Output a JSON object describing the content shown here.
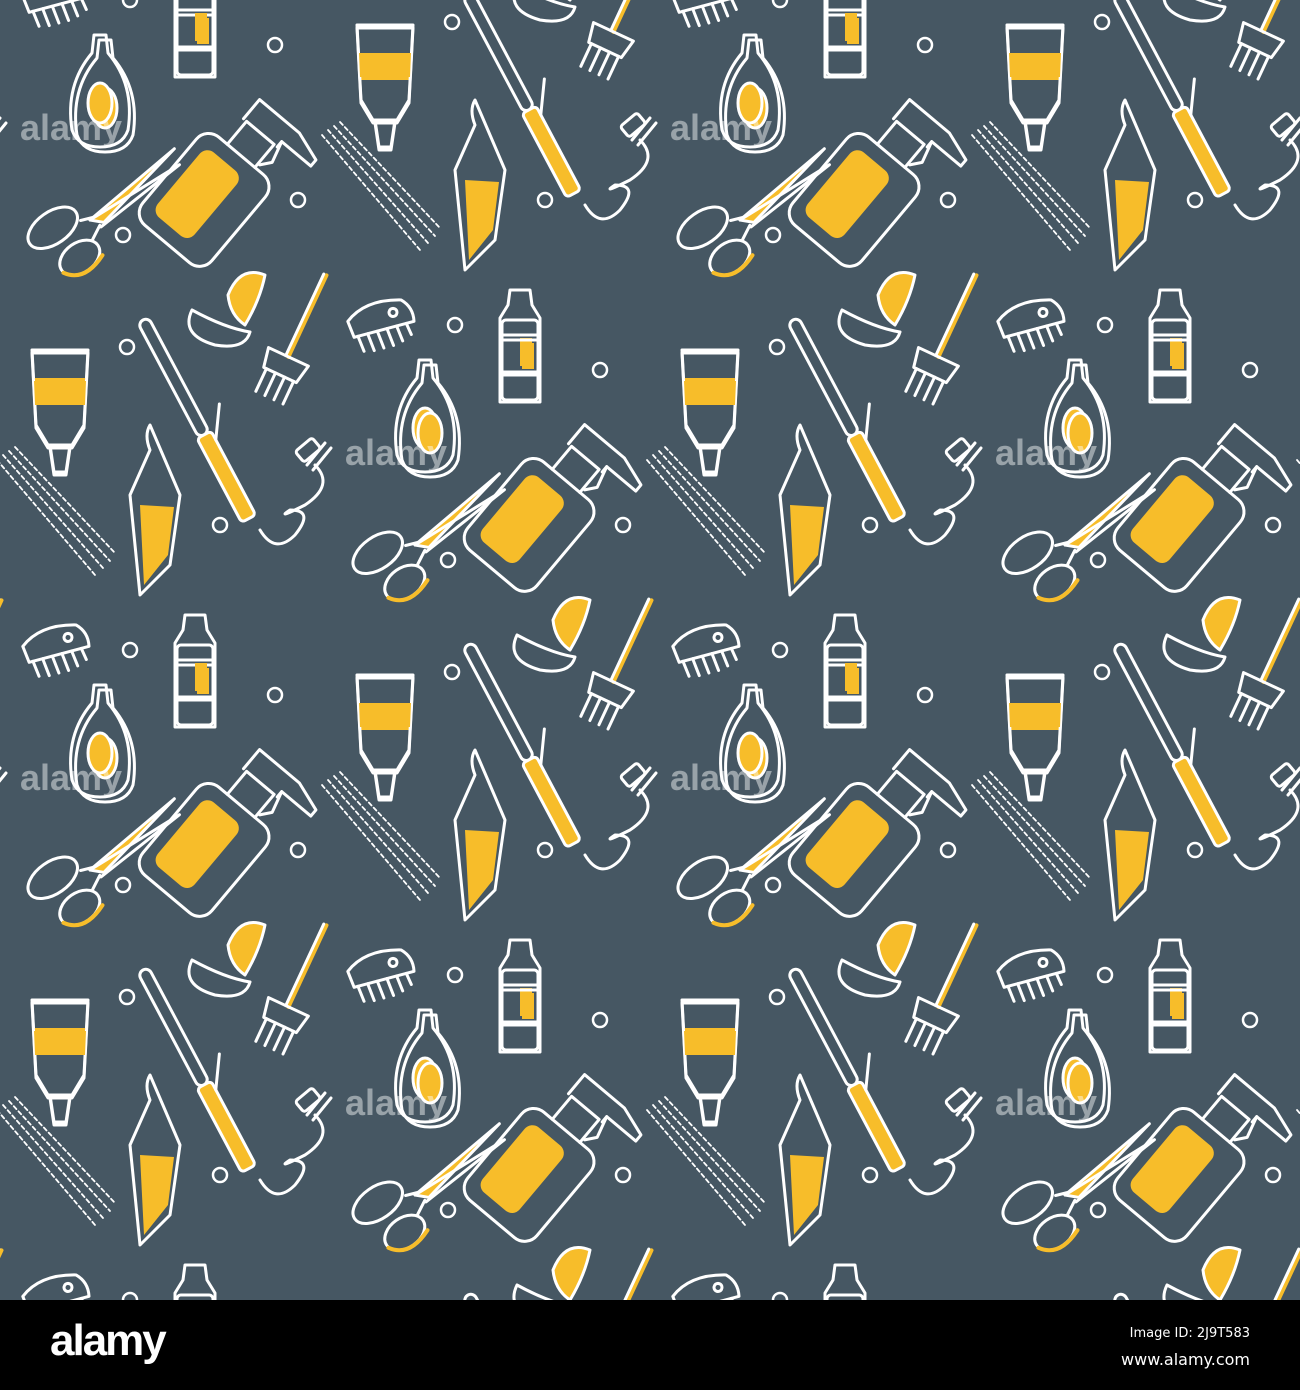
{
  "pattern": {
    "background_color": "#465763",
    "accent_color": "#f7bd2a",
    "line_color": "#ffffff",
    "motifs": [
      "spray-bottle-icon",
      "tube-icon",
      "bottle-icon",
      "oval-bottle-icon",
      "curling-iron-icon",
      "tint-brush-icon",
      "towel-icon",
      "scissors-icon",
      "hair-clip-icon",
      "hair-clip-open-icon",
      "circle-dot-icon"
    ],
    "watermark": "alamy"
  },
  "footer": {
    "logo": "alamy",
    "image_id": "Image ID: 2J9T583",
    "website": "www.alamy.com"
  }
}
